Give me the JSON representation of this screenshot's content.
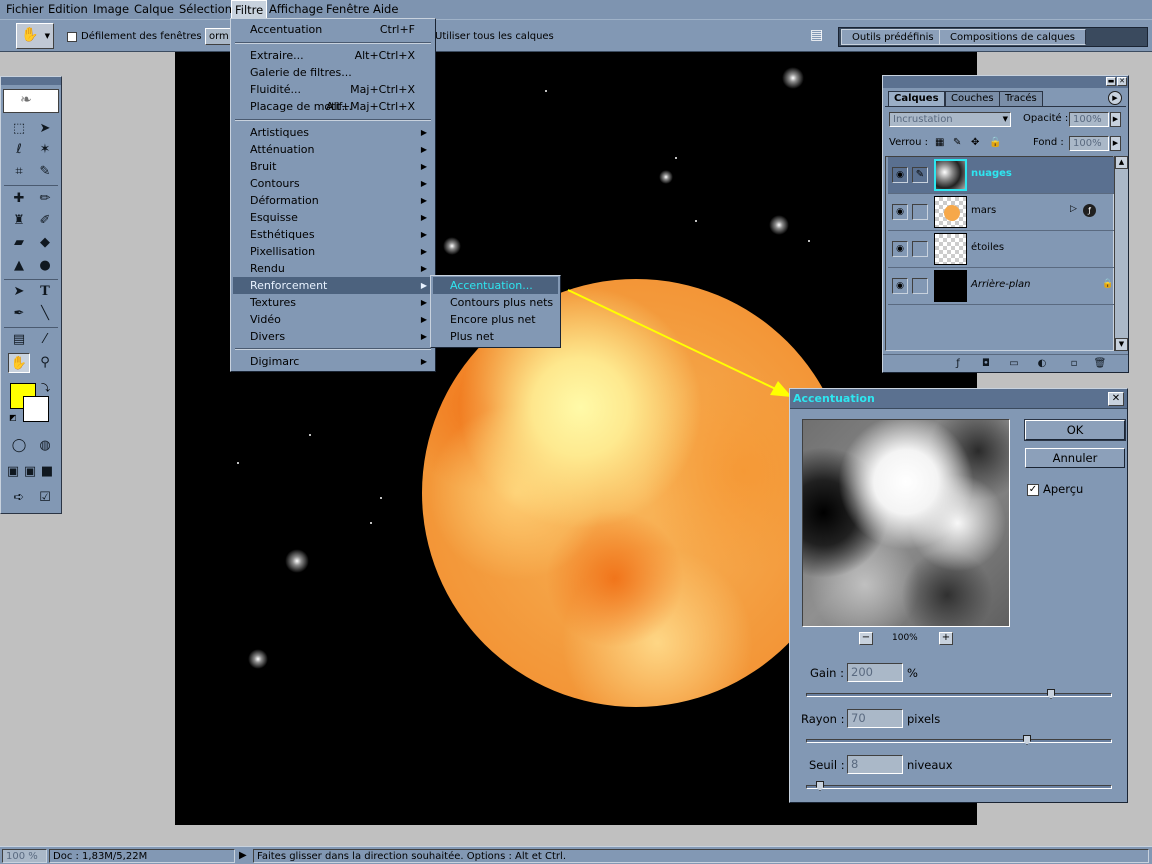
{
  "menubar": {
    "items": [
      "Fichier",
      "Edition",
      "Image",
      "Calque",
      "Sélection",
      "Filtre",
      "Affichage",
      "Fenêtre",
      "Aide"
    ],
    "active": "Filtre"
  },
  "options": {
    "scroll_all_label": "Défilement des fenêtres",
    "format_partial": "orm",
    "use_all_layers": "Utiliser tous les calques",
    "tab_presets": "Outils prédéfinis",
    "tab_comps": "Compositions de calques"
  },
  "filter_menu": {
    "last_filter": "Accentuation",
    "last_filter_shortcut": "Ctrl+F",
    "group1": [
      {
        "label": "Extraire...",
        "shortcut": "Alt+Ctrl+X"
      },
      {
        "label": "Galerie de filtres...",
        "shortcut": ""
      },
      {
        "label": "Fluidité...",
        "shortcut": "Maj+Ctrl+X"
      },
      {
        "label": "Placage de motif...",
        "shortcut": "Alt+Maj+Ctrl+X"
      }
    ],
    "group2": [
      "Artistiques",
      "Atténuation",
      "Bruit",
      "Contours",
      "Déformation",
      "Esquisse",
      "Esthétiques",
      "Pixellisation",
      "Rendu",
      "Renforcement",
      "Textures",
      "Vidéo",
      "Divers"
    ],
    "group2_highlight": "Renforcement",
    "group3": [
      "Digimarc"
    ]
  },
  "submenu": {
    "items": [
      "Accentuation...",
      "Contours plus nets",
      "Encore plus net",
      "Plus net"
    ],
    "highlight": "Accentuation..."
  },
  "layers_panel": {
    "tabs": [
      "Calques",
      "Couches",
      "Tracés"
    ],
    "active_tab": "Calques",
    "blend_mode": "Incrustation",
    "opacity_label": "Opacité :",
    "opacity_value": "100%",
    "lock_label": "Verrou :",
    "fill_label": "Fond :",
    "fill_value": "100%",
    "layers": [
      {
        "name": "nuages",
        "selected": true
      },
      {
        "name": "mars",
        "selected": false
      },
      {
        "name": "étoiles",
        "selected": false
      },
      {
        "name": "Arrière-plan",
        "selected": false
      }
    ]
  },
  "dialog": {
    "title": "Accentuation",
    "ok": "OK",
    "cancel": "Annuler",
    "preview_label": "Aperçu",
    "preview_checked": true,
    "zoom": "100%",
    "amount": {
      "label": "Gain :",
      "value": "200",
      "unit": "%",
      "slider_fraction": 0.81
    },
    "radius": {
      "label": "Rayon :",
      "value": "70",
      "unit": "pixels",
      "slider_fraction": 0.73
    },
    "threshold": {
      "label": "Seuil :",
      "value": "8",
      "unit": "niveaux",
      "slider_fraction": 0.03
    }
  },
  "status": {
    "zoom": "100 %",
    "doc": "Doc : 1,83M/5,22M",
    "hint": "Faites glisser dans la direction souhaitée. Options : Alt et Ctrl."
  },
  "colors": {
    "foreground": "#ffff00",
    "background": "#ffffff",
    "highlight_text": "#2ee6f0",
    "arrow": "#ffff00"
  }
}
